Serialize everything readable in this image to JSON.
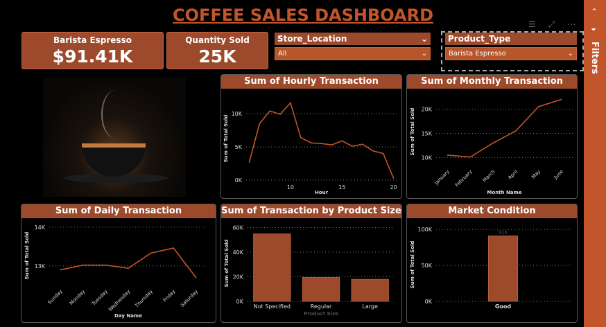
{
  "title": "COFFEE SALES DASHBOARD",
  "kpis": [
    {
      "label": "Barista Espresso",
      "value": "$91.41K"
    },
    {
      "label": "Quantity Sold",
      "value": "25K"
    }
  ],
  "slicers": {
    "store": {
      "label": "Store_Location",
      "value": "All"
    },
    "product": {
      "label": "Product_Type",
      "value": "Barista Espresso"
    }
  },
  "filters_label": "Filters",
  "colors": {
    "accent": "#9c4a2b",
    "line": "#c2552a",
    "bg": "#000000"
  },
  "chart_data": [
    {
      "id": "hourly",
      "type": "line",
      "title": "Sum of Hourly Transaction",
      "xlabel": "Hour",
      "ylabel": "Sum of Total Sold",
      "x": [
        6,
        7,
        8,
        9,
        10,
        11,
        12,
        13,
        14,
        15,
        16,
        17,
        18,
        19,
        20
      ],
      "values": [
        2700,
        8500,
        10400,
        9900,
        11600,
        6400,
        5600,
        5500,
        5300,
        5900,
        5100,
        5400,
        4400,
        4000,
        300
      ],
      "ylim": [
        0,
        12500
      ],
      "yticks": [
        0,
        5000,
        10000
      ],
      "ytick_labels": [
        "0K",
        "5K",
        "10K"
      ],
      "xticks": [
        10,
        15,
        20
      ],
      "xlim": [
        5.7,
        20.3
      ]
    },
    {
      "id": "monthly",
      "type": "line",
      "title": "Sum of Monthly Transaction",
      "xlabel": "Month Name",
      "ylabel": "Sum of Total Sold",
      "categories": [
        "January",
        "February",
        "March",
        "April",
        "May",
        "June"
      ],
      "values": [
        10500,
        10100,
        13000,
        15500,
        20500,
        22000
      ],
      "ylim": [
        8200,
        22500
      ],
      "yticks": [
        10000,
        15000,
        20000
      ],
      "ytick_labels": [
        "10K",
        "15K",
        "20K"
      ]
    },
    {
      "id": "daily",
      "type": "line",
      "title": "Sum of Daily Transaction",
      "xlabel": "Day Name",
      "ylabel": "Sum of Total Sold",
      "categories": [
        "Sunday",
        "Monday",
        "Tuesday",
        "Wednesday",
        "Thursday",
        "Friday",
        "Saturday"
      ],
      "values": [
        12900,
        13020,
        13020,
        12940,
        13330,
        13460,
        12700
      ],
      "ylim": [
        12480,
        14050
      ],
      "yticks": [
        13000,
        14000
      ],
      "ytick_labels": [
        "13K",
        "14K"
      ]
    },
    {
      "id": "size",
      "type": "bar",
      "title": "Sum of Transaction by Product Size",
      "xlabel": "Product Size",
      "ylabel": "Sum of Total Sold",
      "categories": [
        "Not Specified",
        "Regular",
        "Large"
      ],
      "values": [
        55000,
        19500,
        18000
      ],
      "ylim": [
        0,
        62000
      ],
      "yticks": [
        0,
        20000,
        40000,
        60000
      ],
      "ytick_labels": [
        "0K",
        "20K",
        "40K",
        "60K"
      ]
    },
    {
      "id": "market",
      "type": "bar",
      "title": "Market Condition",
      "xlabel": "",
      "ylabel": "Sum of Total Sold",
      "categories": [
        "Good"
      ],
      "values": [
        91000
      ],
      "data_labels": [
        "91K"
      ],
      "ylim": [
        0,
        102000
      ],
      "yticks": [
        0,
        50000,
        100000
      ],
      "ytick_labels": [
        "0K",
        "50K",
        "100K"
      ]
    }
  ]
}
